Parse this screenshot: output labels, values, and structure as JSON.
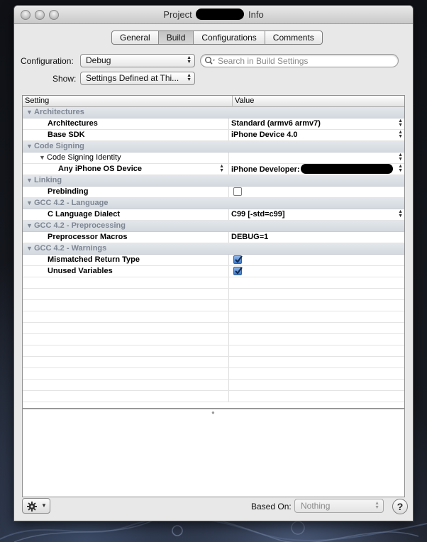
{
  "window": {
    "title_prefix": "Project",
    "title_suffix": "Info"
  },
  "tabs": [
    {
      "label": "General",
      "active": false
    },
    {
      "label": "Build",
      "active": true
    },
    {
      "label": "Configurations",
      "active": false
    },
    {
      "label": "Comments",
      "active": false
    }
  ],
  "config": {
    "configuration_label": "Configuration:",
    "configuration_value": "Debug",
    "show_label": "Show:",
    "show_value": "Settings Defined at Thi...",
    "search_placeholder": "Search in Build Settings"
  },
  "table": {
    "header_setting": "Setting",
    "header_value": "Value",
    "groups": {
      "architectures": "Architectures",
      "code_signing": "Code Signing",
      "linking": "Linking",
      "gcc_language": "GCC 4.2 - Language",
      "gcc_preprocessing": "GCC 4.2 - Preprocessing",
      "gcc_warnings": "GCC 4.2 - Warnings"
    },
    "rows": {
      "architectures": {
        "setting": "Architectures",
        "value": "Standard (armv6 armv7)"
      },
      "base_sdk": {
        "setting": "Base SDK",
        "value": "iPhone Device 4.0"
      },
      "code_signing_identity": {
        "setting": "Code Signing Identity",
        "value": ""
      },
      "any_iphone_os_device": {
        "setting": "Any iPhone OS Device",
        "value": "iPhone Developer:"
      },
      "prebinding": {
        "setting": "Prebinding",
        "checked": false
      },
      "c_language_dialect": {
        "setting": "C Language Dialect",
        "value": "C99 [-std=c99]"
      },
      "preprocessor_macros": {
        "setting": "Preprocessor Macros",
        "value": "DEBUG=1"
      },
      "mismatched_return_type": {
        "setting": "Mismatched Return Type",
        "checked": true
      },
      "unused_variables": {
        "setting": "Unused Variables",
        "checked": true
      }
    }
  },
  "bottom": {
    "based_on_label": "Based On:",
    "based_on_value": "Nothing",
    "help_label": "?"
  },
  "icons": {
    "gear": "gear-icon",
    "search": "magnifier-icon",
    "help": "question-mark-icon"
  }
}
